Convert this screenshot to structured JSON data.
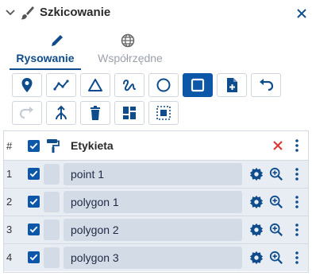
{
  "panel": {
    "title": "Szkicowanie"
  },
  "tabs": [
    {
      "label": "Rysowanie",
      "icon": "pencil-icon",
      "active": true
    },
    {
      "label": "Współrzędne",
      "icon": "globe-icon",
      "active": false
    }
  ],
  "toolbar": {
    "tools": [
      {
        "name": "point-tool",
        "icon": "map-pin-icon"
      },
      {
        "name": "polyline-tool",
        "icon": "polyline-icon"
      },
      {
        "name": "triangle-tool",
        "icon": "triangle-icon"
      },
      {
        "name": "freehand-tool",
        "icon": "freehand-icon"
      },
      {
        "name": "circle-tool",
        "icon": "circle-icon"
      },
      {
        "name": "rectangle-tool",
        "icon": "square-icon",
        "active": true
      },
      {
        "name": "add-file-tool",
        "icon": "file-plus-icon"
      },
      {
        "name": "undo-tool",
        "icon": "undo-icon"
      },
      {
        "name": "redo-tool",
        "icon": "redo-icon",
        "disabled": true
      },
      {
        "name": "merge-tool",
        "icon": "merge-icon"
      },
      {
        "name": "delete-tool",
        "icon": "trash-icon"
      },
      {
        "name": "layout-tool",
        "icon": "dashboard-icon"
      },
      {
        "name": "select-area-tool",
        "icon": "select-area-icon"
      }
    ]
  },
  "table": {
    "header": {
      "number": "#",
      "label": "Etykieta"
    },
    "rows": [
      {
        "number": "1",
        "label": "point 1"
      },
      {
        "number": "2",
        "label": "polygon 1"
      },
      {
        "number": "3",
        "label": "polygon 2"
      },
      {
        "number": "4",
        "label": "polygon 3"
      }
    ]
  },
  "colors": {
    "accent": "#0d57a8",
    "delete": "#e03131",
    "row_bg": "#e8edf4"
  }
}
